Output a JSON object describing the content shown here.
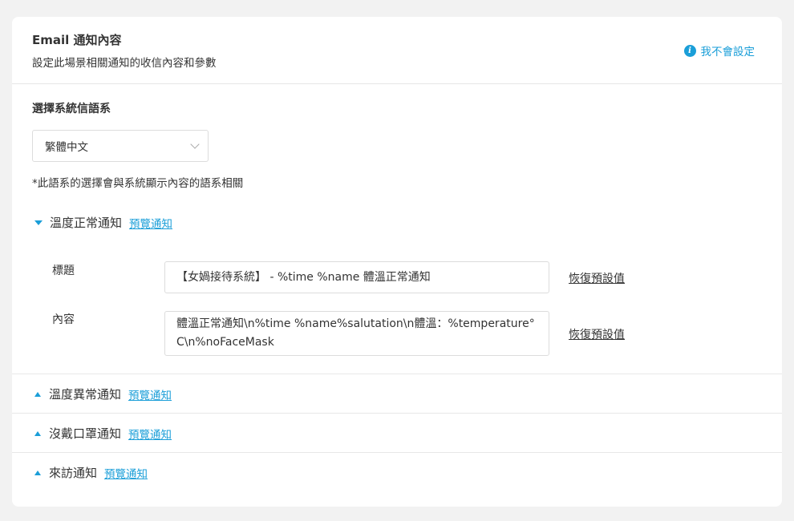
{
  "header": {
    "title": "Email 通知內容",
    "subtitle": "設定此場景相關通知的收信內容和參數",
    "help_label": "我不會設定",
    "help_icon": "info-icon"
  },
  "language": {
    "label": "選擇系統信語系",
    "selected": "繁體中文",
    "note": "*此語系的選擇會與系統顯示內容的語系相關"
  },
  "sections": [
    {
      "title": "溫度正常通知",
      "preview": "預覽通知",
      "expanded": true,
      "fields": [
        {
          "label": "標題",
          "value": "【女媧接待系統】 -  %time %name 體溫正常通知",
          "reset": "恢復預設值"
        },
        {
          "label": "內容",
          "value": "體溫正常通知\\n%time %name%salutation\\n體溫：%temperature°C\\n%noFaceMask",
          "reset": "恢復預設值"
        }
      ]
    },
    {
      "title": "溫度異常通知",
      "preview": "預覽通知",
      "expanded": false
    },
    {
      "title": "沒戴口罩通知",
      "preview": "預覽通知",
      "expanded": false
    },
    {
      "title": "來訪通知",
      "preview": "預覽通知",
      "expanded": false
    }
  ],
  "colors": {
    "accent": "#1a9ed8",
    "background": "#f2f2f2",
    "card": "#ffffff",
    "border": "#dcdcdc"
  }
}
